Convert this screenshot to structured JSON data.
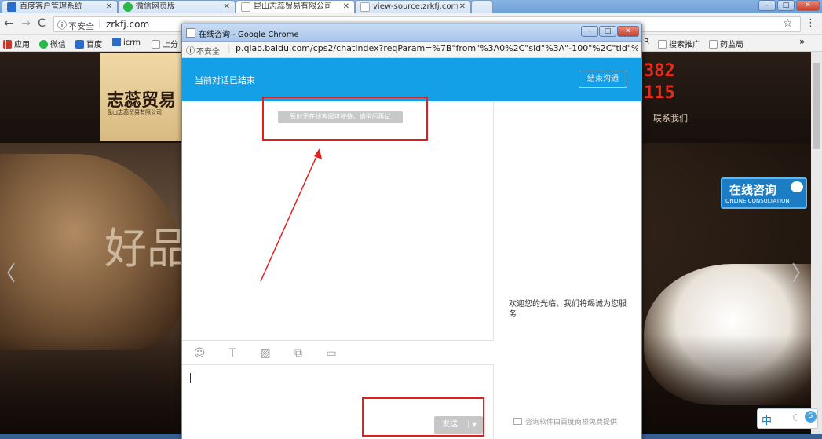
{
  "browser": {
    "tabs": [
      {
        "label": "百度客户管理系统",
        "icon_color": "#2a6ccc"
      },
      {
        "label": "微信网页版",
        "icon_color": "#2bb84a"
      },
      {
        "label": "昆山志蕊贸易有限公司",
        "icon_color": "#d9d9d9"
      },
      {
        "label": "view-source:zrkfj.com",
        "icon_color": "#d9d9d9"
      }
    ],
    "security_label": "不安全",
    "url": "zrkfj.com",
    "star_icon": "star-icon",
    "bookmarks": [
      {
        "label": "应用",
        "icon_color": "#c0392b"
      },
      {
        "label": "微信",
        "icon_color": "#2bb84a"
      },
      {
        "label": "百度",
        "icon_color": "#2a6ccc"
      },
      {
        "label": "icrm",
        "icon_color": "#2a6ccc"
      },
      {
        "label": "上分",
        "icon_color": "#999999"
      }
    ],
    "bookmarks_right": [
      {
        "label": "R"
      },
      {
        "label": "搜索推广",
        "icon_color": "#999999"
      },
      {
        "label": "药监局",
        "icon_color": "#999999"
      }
    ],
    "bookmarks_more": "»"
  },
  "site": {
    "logo_title": "志蕊贸易",
    "logo_subtitle": "昆山志蕊贸易有限公司",
    "phone_line1": "382",
    "phone_line2": "115",
    "nav_contact": "联系我们",
    "banner_text": "好品",
    "consult_title": "在线咨询",
    "consult_subtitle": "ONLINE CONSULTATION",
    "prev_arrow": "〈",
    "next_arrow": "〉"
  },
  "popup": {
    "window_title": "在线咨询 - Google Chrome",
    "security_label": "不安全",
    "url": "p.qiao.baidu.com/cps2/chatIndex?reqParam=%7B\"from\"%3A0%2C\"sid\"%3A\"-100\"%2C\"tid\"%3A...",
    "status": "当前对话已结束",
    "end_button": "结束沟通",
    "notice": "暂时无在线客服可接待，请稍后再试",
    "welcome": "欢迎您的光临，我们将竭诚为您服务",
    "send_button": "发送",
    "footer": "咨询软件由百度商桥免费提供",
    "input_value": ""
  },
  "ime": {
    "label": "中"
  }
}
